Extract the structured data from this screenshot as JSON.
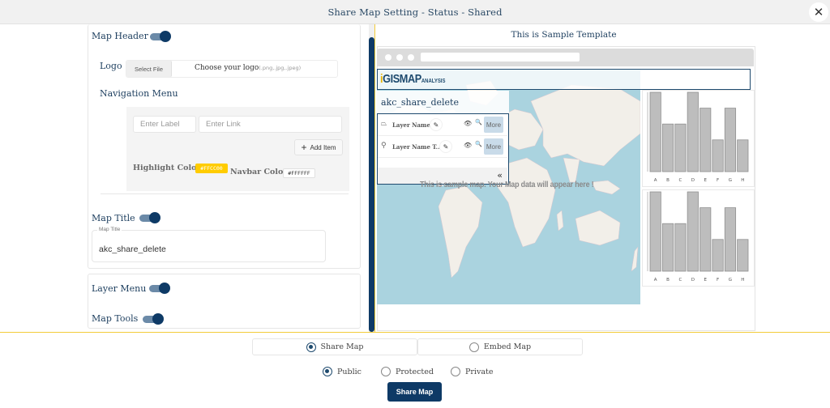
{
  "dialog": {
    "title": "Share Map Setting - Status - Shared",
    "close_icon": "close-icon"
  },
  "settings": {
    "map_header": {
      "label": "Map Header",
      "enabled": true
    },
    "logo": {
      "label": "Logo",
      "select_button": "Select File",
      "placeholder": "Choose your logo",
      "extensions": "(.png,.jpg,.jpeg)"
    },
    "navigation_menu": {
      "label": "Navigation Menu",
      "label_placeholder": "Enter Label",
      "link_placeholder": "Enter Link",
      "add_item_label": "Add Item",
      "add_icon": "plus-icon",
      "highlight_color_label": "Highlight Color",
      "highlight_color": "#FFCC00",
      "navbar_color_label": "Navbar Color",
      "navbar_color": "#FFFFFF"
    },
    "map_title": {
      "label": "Map Title",
      "enabled": true,
      "field_label": "Map Title",
      "value": "akc_share_delete"
    },
    "layer_menu": {
      "label": "Layer Menu",
      "enabled": true
    },
    "map_tools": {
      "label": "Map Tools",
      "enabled": true
    }
  },
  "preview": {
    "heading": "This is Sample Template",
    "logo": {
      "main": "GISMAP",
      "sub": "ANALYSIS"
    },
    "map_title": "akc_share_delete",
    "layers": [
      {
        "icon": "polygon-icon",
        "name": "Layer Name",
        "more": "More"
      },
      {
        "icon": "map-pin-icon",
        "name": "Layer Name T...",
        "more": "More"
      }
    ],
    "collapse_icon": "«",
    "sample_message": "This is sample map. Your Map data will appear here !",
    "colors": {
      "header_border": "#1e4a6e",
      "map_water": "#aad3df",
      "bar_fill": "#bdbdbd"
    }
  },
  "chart_data": [
    {
      "type": "bar",
      "title": "",
      "categories": [
        "A",
        "B",
        "C",
        "D",
        "E",
        "F",
        "G",
        "H"
      ],
      "values": [
        5,
        3,
        3,
        5,
        4,
        2,
        4,
        2
      ],
      "xlabel": "",
      "ylabel": "",
      "ylim": [
        0,
        5
      ],
      "grid": false
    },
    {
      "type": "bar",
      "title": "",
      "categories": [
        "A",
        "B",
        "C",
        "D",
        "E",
        "F",
        "G",
        "H"
      ],
      "values": [
        5,
        3,
        3,
        5,
        4,
        2,
        4,
        2
      ],
      "xlabel": "",
      "ylabel": "",
      "ylim": [
        0,
        5
      ],
      "grid": false
    }
  ],
  "share": {
    "tabs": [
      {
        "label": "Share Map",
        "selected": true
      },
      {
        "label": "Embed Map",
        "selected": false
      }
    ],
    "privacy": [
      {
        "label": "Public",
        "selected": true
      },
      {
        "label": "Protected",
        "selected": false
      },
      {
        "label": "Private",
        "selected": false
      }
    ],
    "submit_label": "Share Map",
    "accent": "#0e3a66",
    "divider_color": "#f3cc3a"
  }
}
